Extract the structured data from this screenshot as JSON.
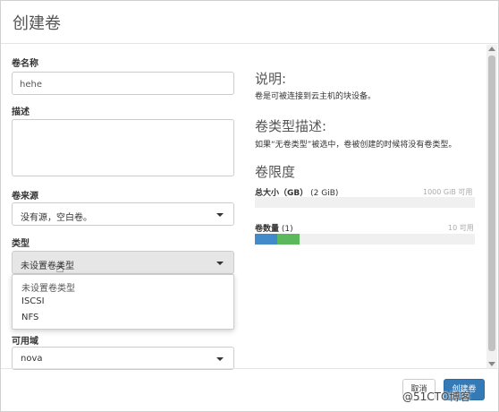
{
  "dialog": {
    "title": "创建卷"
  },
  "form": {
    "name_label": "卷名称",
    "name_value": "hehe",
    "desc_label": "描述",
    "desc_value": "",
    "source_label": "卷来源",
    "source_value": "没有源，空白卷。",
    "type_label": "类型",
    "type_value": "未设置卷类型",
    "type_options": [
      "未设置卷类型",
      "ISCSI",
      "NFS"
    ],
    "az_label": "可用域",
    "az_value": "nova"
  },
  "info": {
    "desc_heading": "说明:",
    "desc_text": "卷是可被连接到云主机的块设备。",
    "type_heading": "卷类型描述:",
    "type_text": "如果“无卷类型”被选中，卷被创建的时候将没有卷类型。",
    "limits_heading": "卷限度",
    "size_label": "总大小（GB）",
    "size_used": "(2 GiB)",
    "size_available": "1000 GiB 可用",
    "size_used_fraction": 0.002,
    "count_label": "卷数量",
    "count_used": "(1)",
    "count_available": "10 可用",
    "count_used_fraction": 0.1,
    "count_new_fraction": 0.1,
    "colors": {
      "used": "#428bca",
      "new": "#5cb85c"
    }
  },
  "footer": {
    "cancel_label": "取消",
    "create_label": "创建卷"
  },
  "watermark": "@51CTO博客"
}
